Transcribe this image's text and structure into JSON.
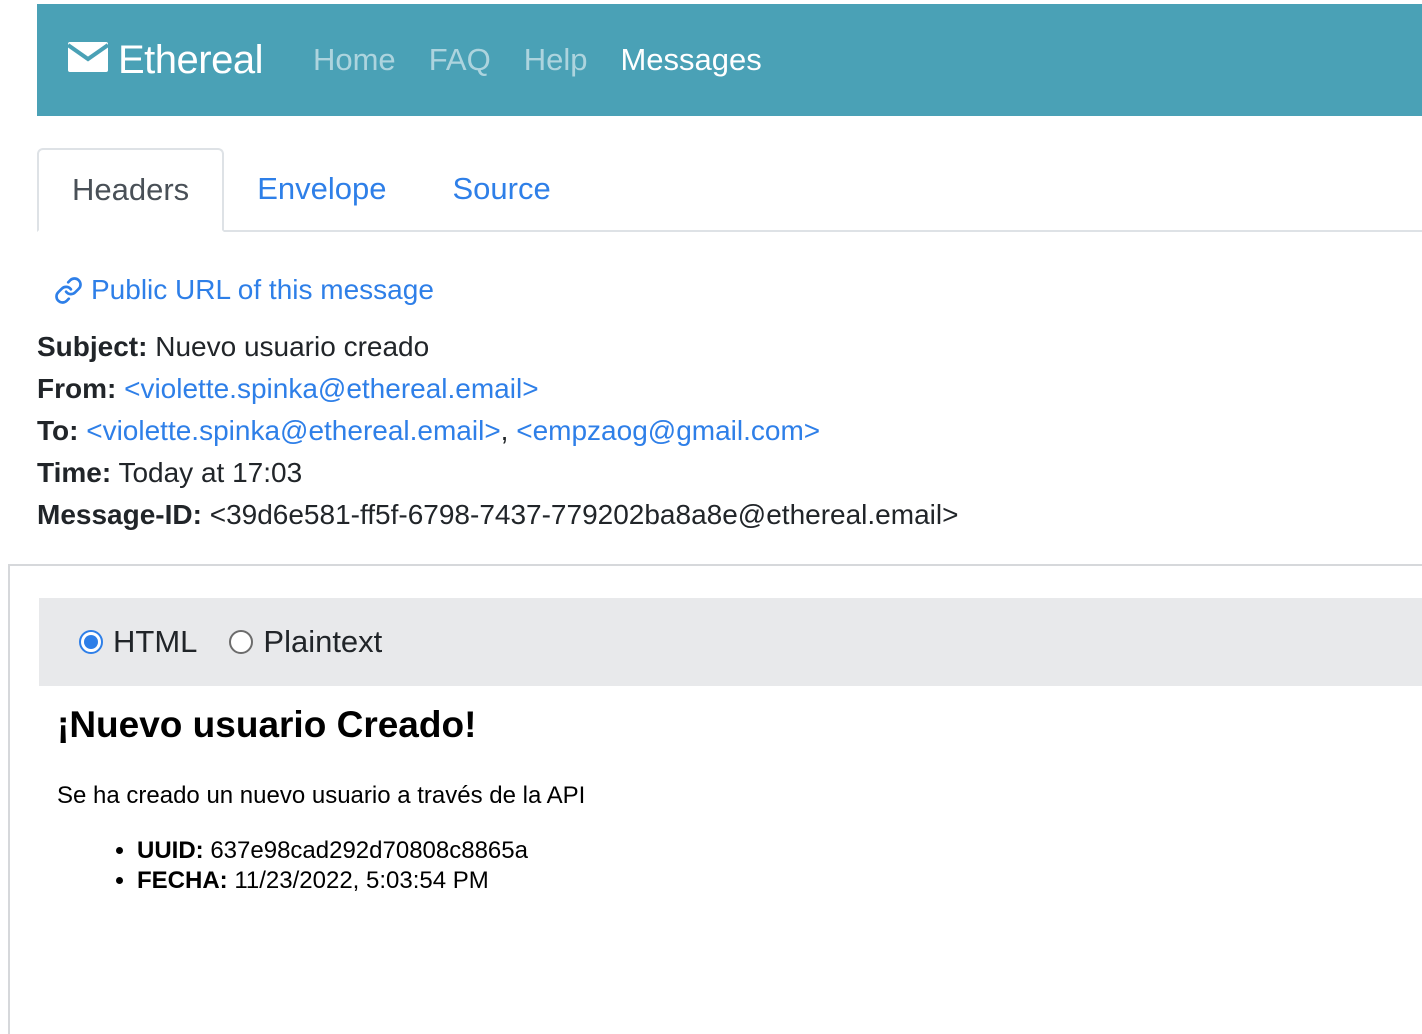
{
  "navbar": {
    "brand": "Ethereal",
    "links": [
      "Home",
      "FAQ",
      "Help",
      "Messages"
    ],
    "active": "Messages"
  },
  "tabs": {
    "items": [
      "Headers",
      "Envelope",
      "Source"
    ],
    "active": "Headers"
  },
  "public_url": {
    "label": "Public URL of this message",
    "icon": "link-icon"
  },
  "headers": {
    "subject_label": "Subject:",
    "subject": "Nuevo usuario creado",
    "from_label": "From:",
    "from": "<violette.spinka@ethereal.email>",
    "to_label": "To:",
    "to": [
      "<violette.spinka@ethereal.email>",
      "<empzaog@gmail.com>"
    ],
    "to_separator": ",",
    "time_label": "Time:",
    "time": "Today at 17:03",
    "message_id_label": "Message-ID:",
    "message_id": "<39d6e581-ff5f-6798-7437-779202ba8a8e@ethereal.email>"
  },
  "viewer": {
    "options": [
      {
        "label": "HTML",
        "checked": true
      },
      {
        "label": "Plaintext",
        "checked": false
      }
    ]
  },
  "email": {
    "title": "¡Nuevo usuario Creado!",
    "text": "Se ha creado un nuevo usuario a través de la API",
    "items": [
      {
        "label": "UUID:",
        "value": "637e98cad292d70808c8865a"
      },
      {
        "label": "FECHA:",
        "value": "11/23/2022, 5:03:54 PM"
      }
    ]
  },
  "colors": {
    "navbar_bg": "#4aa1b6",
    "link": "#2e7fe8",
    "toggle_bg": "#e8e9eb"
  }
}
